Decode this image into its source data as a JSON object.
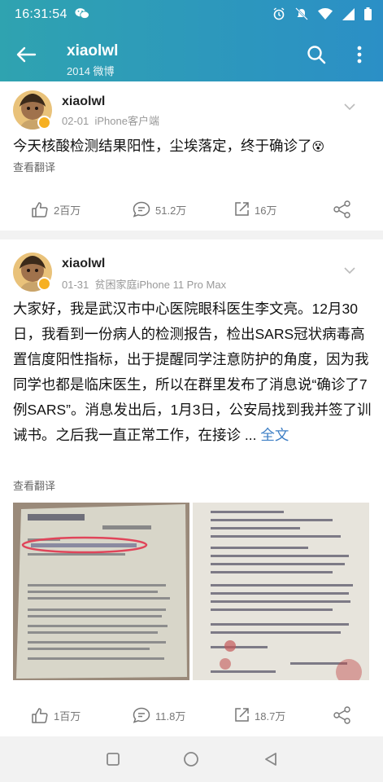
{
  "status_bar": {
    "time": "16:31:54",
    "icons": [
      "wechat-icon",
      "alarm-icon",
      "mute-icon",
      "wifi-icon",
      "signal-icon",
      "battery-icon"
    ]
  },
  "nav": {
    "title": "xiaolwl",
    "subtitle": "2014 微博",
    "icons": [
      "back-arrow-icon",
      "search-icon",
      "more-vertical-icon"
    ]
  },
  "posts": [
    {
      "username": "xiaolwl",
      "date": "02-01",
      "source": "iPhone客户端",
      "text": "今天核酸检测结果阳性，尘埃落定，终于确诊了",
      "emoji": "😵",
      "translate_label": "查看翻译",
      "likes": "2百万",
      "comments": "51.2万",
      "reposts": "16万"
    },
    {
      "username": "xiaolwl",
      "date": "01-31",
      "source": "贫困家庭iPhone 11 Pro Max",
      "text": "大家好，我是武汉市中心医院眼科医生李文亮。12月30日，我看到一份病人的检测报告，检出SARS冠状病毒高置信度阳性指标，出于提醒同学注意防护的角度，因为我同学也都是临床医生，所以在群里发布了消息说“确诊了7例SARS”。消息发出后，1月3日，公安局找到我并签了训诫书。之后我一直正常工作，在接诊 ...",
      "more_label": "全文",
      "translate_label": "查看翻译",
      "likes": "1百万",
      "comments": "11.8万",
      "reposts": "18.7万"
    }
  ],
  "colors": {
    "header_start": "#2fa3b0",
    "header_end": "#2b8fc6",
    "link": "#3e7fc5",
    "badge": "#f6b022"
  }
}
